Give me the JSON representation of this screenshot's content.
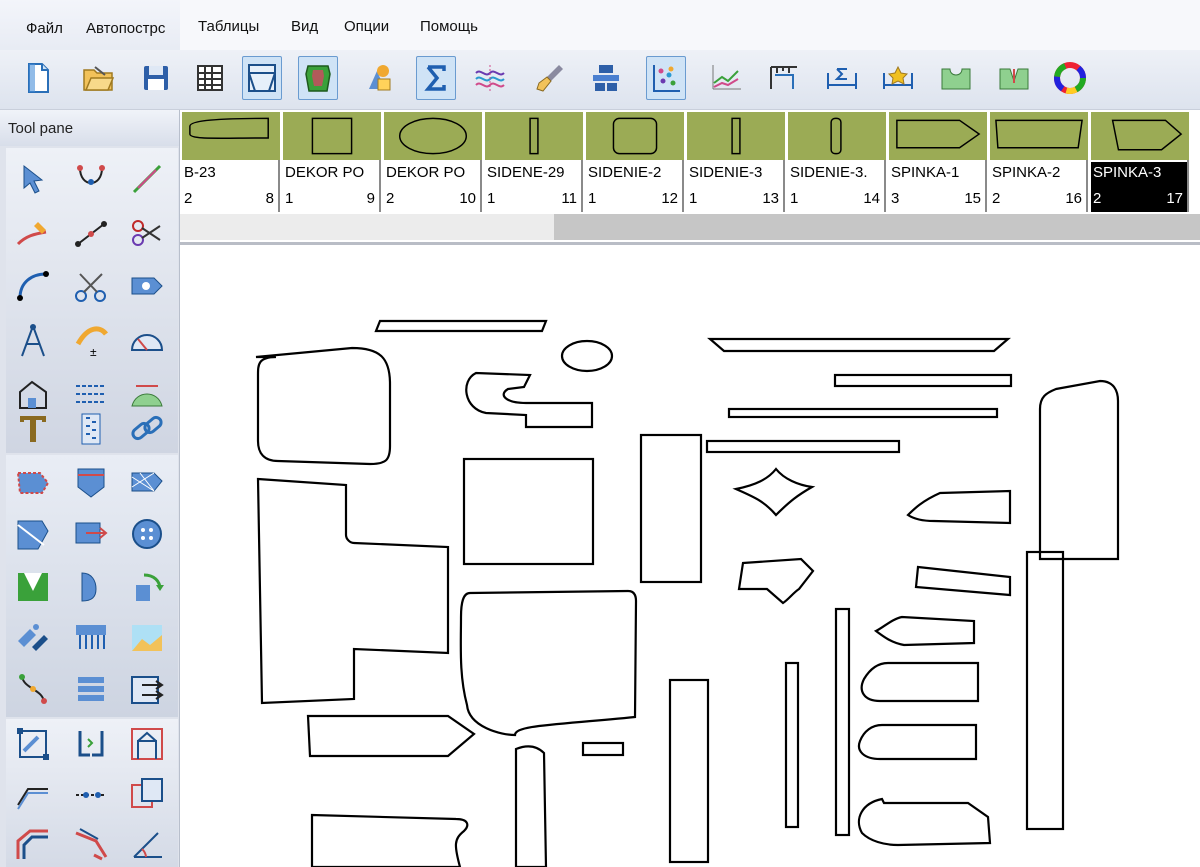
{
  "menu": [
    "Файл",
    "Автопострс",
    "Таблицы",
    "Вид",
    "Опции",
    "Помощь"
  ],
  "toolbar": {
    "icons": [
      "new-file-icon",
      "open-folder-icon",
      "save-icon",
      "grid-table-icon",
      "window-frame-icon",
      "shield-piece-icon",
      "lock-pieces-icon",
      "sigma-icon",
      "waves-icon",
      "brush-icon",
      "layers-icon",
      "scatter-icon",
      "line-graph-icon",
      "measure-grid-icon",
      "dimension-sigma-icon",
      "star-dimension-icon",
      "curve-u-icon",
      "curve-v-icon",
      "color-wheel-icon"
    ],
    "number_value": "2",
    "accent": "#6a9bd0"
  },
  "toolpane": {
    "title": "Tool pane"
  },
  "pieces": [
    {
      "name": "B-23",
      "qty": "2",
      "num": "8"
    },
    {
      "name": "DEKOR PO",
      "qty": "1",
      "num": "9"
    },
    {
      "name": "DEKOR PO",
      "qty": "2",
      "num": "10"
    },
    {
      "name": "SIDENE-29",
      "qty": "1",
      "num": "11"
    },
    {
      "name": "SIDENIE-2",
      "qty": "1",
      "num": "12"
    },
    {
      "name": "SIDENIE-3",
      "qty": "1",
      "num": "13"
    },
    {
      "name": "SIDENIE-3.",
      "qty": "1",
      "num": "14"
    },
    {
      "name": "SPINKA-1",
      "qty": "3",
      "num": "15"
    },
    {
      "name": "SPINKA-2",
      "qty": "2",
      "num": "16"
    },
    {
      "name": "SPINKA-3",
      "qty": "2",
      "num": "17"
    }
  ],
  "colors": {
    "thumb": "#9bab55",
    "selected": "#000000"
  }
}
